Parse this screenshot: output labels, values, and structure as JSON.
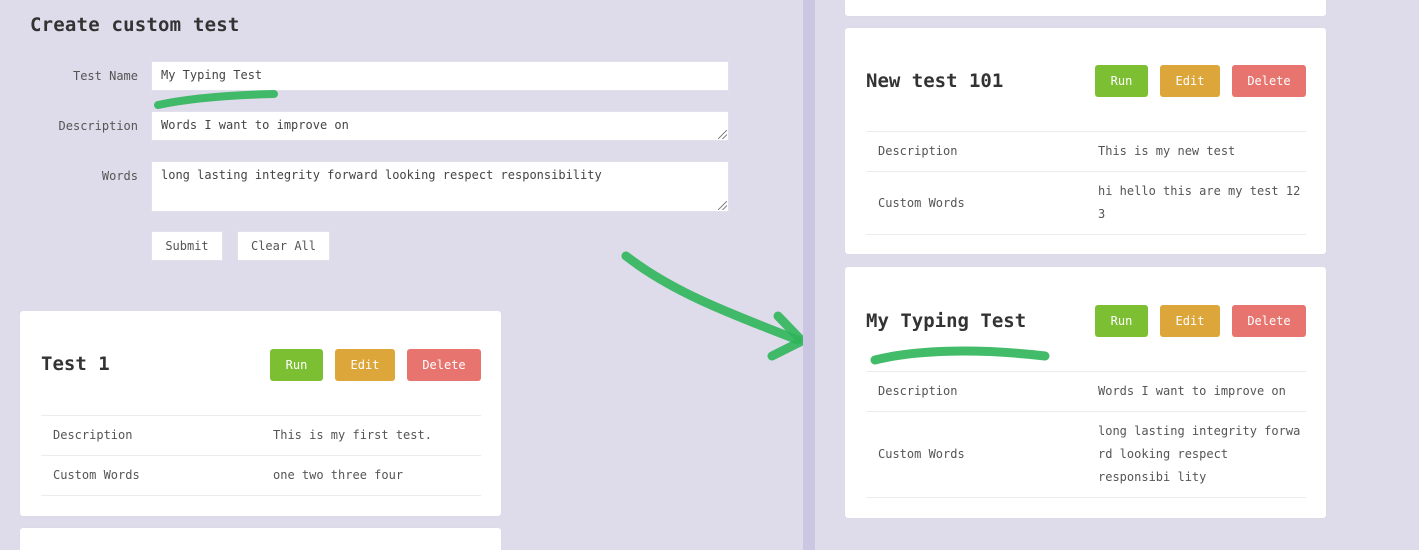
{
  "create_form": {
    "title": "Create custom test",
    "test_name_label": "Test Name",
    "test_name_value": "My Typing Test",
    "description_label": "Description",
    "description_value": "Words I want to improve on",
    "words_label": "Words",
    "words_value": "long lasting integrity forward looking respect responsibility",
    "submit_label": "Submit",
    "clear_label": "Clear All"
  },
  "left_cards": [
    {
      "title": "Test 1",
      "run": "Run",
      "edit": "Edit",
      "delete": "Delete",
      "description_label": "Description",
      "description_value": "This is my first test.",
      "words_label": "Custom Words",
      "words_value": "one two three four"
    }
  ],
  "right_cards": [
    {
      "title": "New test 101",
      "run": "Run",
      "edit": "Edit",
      "delete": "Delete",
      "description_label": "Description",
      "description_value": "This is my new test",
      "words_label": "Custom Words",
      "words_value": "hi hello this are my test 12 3"
    },
    {
      "title": "My Typing Test",
      "run": "Run",
      "edit": "Edit",
      "delete": "Delete",
      "description_label": "Description",
      "description_value": "Words I want to improve on",
      "words_label": "Custom Words",
      "words_value": "long lasting integrity forwa rd looking respect responsibi lity"
    }
  ],
  "colors": {
    "background": "#dedbea",
    "run": "#7dbf32",
    "edit": "#dca63b",
    "delete": "#e8746f",
    "annotation": "#2fb55a"
  }
}
